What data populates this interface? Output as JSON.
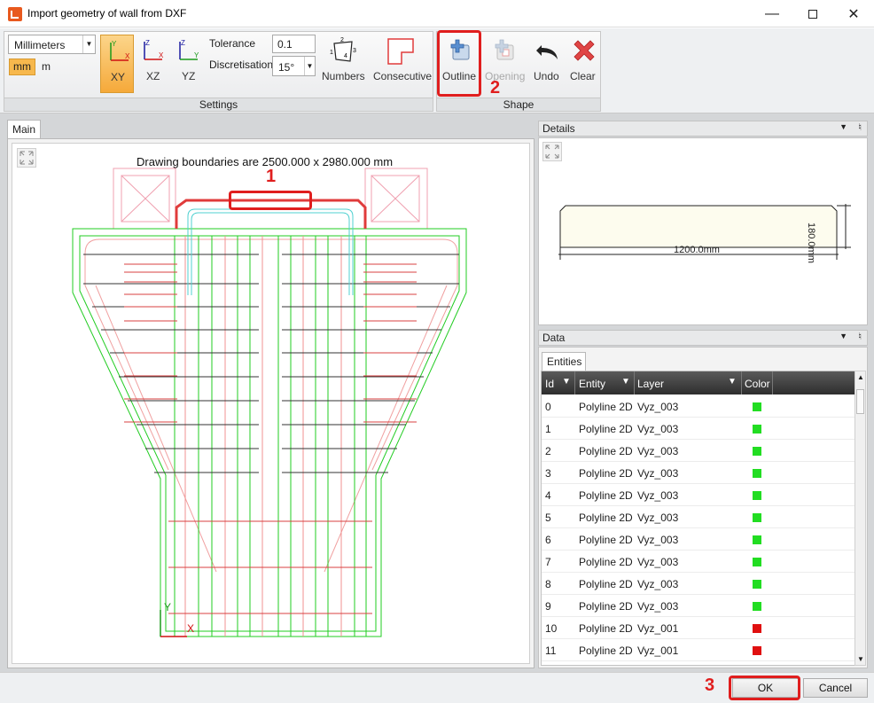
{
  "window": {
    "title": "Import geometry of wall from DXF",
    "minimize_icon": "minimize-icon",
    "maximize_icon": "maximize-icon",
    "close_icon": "close-icon"
  },
  "ribbon": {
    "settings": {
      "label": "Settings",
      "units_select": "Millimeters",
      "unit_mm": "mm",
      "unit_m": "m",
      "planes": [
        {
          "label": "XY",
          "axis_v": "Y",
          "axis_h": "X",
          "active": true
        },
        {
          "label": "XZ",
          "axis_v": "Z",
          "axis_h": "X",
          "active": false
        },
        {
          "label": "YZ",
          "axis_v": "Z",
          "axis_h": "Y",
          "active": false
        }
      ],
      "tolerance_label": "Tolerance",
      "tolerance_value": "0.1",
      "discretisation_label": "Discretisation",
      "discretisation_value": "15°",
      "numbers_label": "Numbers",
      "numbers_icon_digits": [
        "1",
        "2",
        "3",
        "4"
      ],
      "consecutive_label": "Consecutive"
    },
    "shape": {
      "label": "Shape",
      "outline_label": "Outline",
      "opening_label": "Opening",
      "undo_label": "Undo",
      "clear_label": "Clear"
    }
  },
  "main": {
    "tab_label": "Main",
    "boundaries_text": "Drawing boundaries are 2500.000 x 2980.000 mm",
    "axis_y": "Y",
    "axis_x": "X"
  },
  "details": {
    "title": "Details",
    "width_dim": "1200.0mm",
    "height_dim": "180.0mm"
  },
  "data": {
    "title": "Data",
    "tab_label": "Entities",
    "columns": [
      "Id",
      "Entity",
      "Layer",
      "Color"
    ],
    "rows": [
      {
        "id": "0",
        "entity": "Polyline 2D",
        "layer": "Vyz_003",
        "color": "#22dd22"
      },
      {
        "id": "1",
        "entity": "Polyline 2D",
        "layer": "Vyz_003",
        "color": "#22dd22"
      },
      {
        "id": "2",
        "entity": "Polyline 2D",
        "layer": "Vyz_003",
        "color": "#22dd22"
      },
      {
        "id": "3",
        "entity": "Polyline 2D",
        "layer": "Vyz_003",
        "color": "#22dd22"
      },
      {
        "id": "4",
        "entity": "Polyline 2D",
        "layer": "Vyz_003",
        "color": "#22dd22"
      },
      {
        "id": "5",
        "entity": "Polyline 2D",
        "layer": "Vyz_003",
        "color": "#22dd22"
      },
      {
        "id": "6",
        "entity": "Polyline 2D",
        "layer": "Vyz_003",
        "color": "#22dd22"
      },
      {
        "id": "7",
        "entity": "Polyline 2D",
        "layer": "Vyz_003",
        "color": "#22dd22"
      },
      {
        "id": "8",
        "entity": "Polyline 2D",
        "layer": "Vyz_003",
        "color": "#22dd22"
      },
      {
        "id": "9",
        "entity": "Polyline 2D",
        "layer": "Vyz_003",
        "color": "#22dd22"
      },
      {
        "id": "10",
        "entity": "Polyline 2D",
        "layer": "Vyz_001",
        "color": "#e01010"
      },
      {
        "id": "11",
        "entity": "Polyline 2D",
        "layer": "Vyz_001",
        "color": "#e01010"
      }
    ]
  },
  "callouts": [
    "1",
    "2",
    "3"
  ],
  "buttons": {
    "ok": "OK",
    "cancel": "Cancel"
  },
  "colors": {
    "highlight": "#e01e1e",
    "active_plane": "#f7b84d",
    "outline": "#e03b3b",
    "green_lines": "#22cc22",
    "pink_lines": "#f09090"
  }
}
